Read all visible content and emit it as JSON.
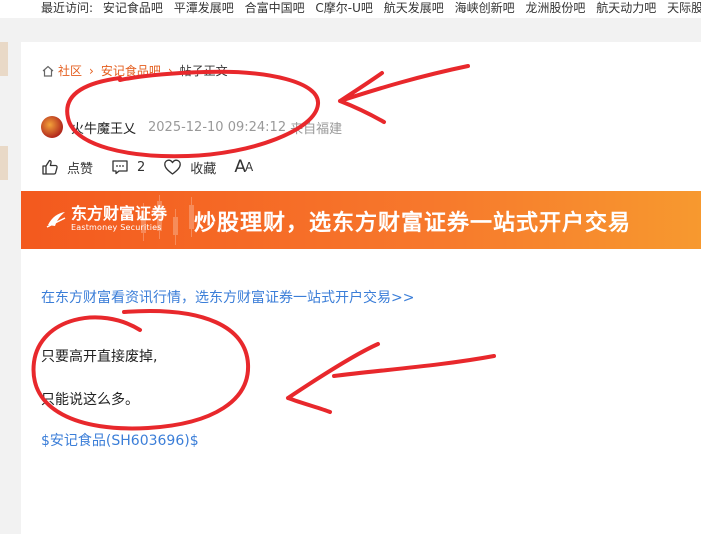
{
  "recent": {
    "label": "最近访问:",
    "items": [
      "安记食品吧",
      "平潭发展吧",
      "合富中国吧",
      "C摩尔-U吧",
      "航天发展吧",
      "海峡创新吧",
      "龙洲股份吧",
      "航天动力吧",
      "天际股份吧",
      "..."
    ]
  },
  "breadcrumb": {
    "home": "社区",
    "bar": "安记食品吧",
    "current": "帖子正文"
  },
  "author": {
    "name": "火牛魔王乂",
    "time": "2025-12-10 09:24:12",
    "location": "来自福建"
  },
  "actions": {
    "like": "点赞",
    "comments": "2",
    "favorite": "收藏",
    "font_big": "A",
    "font_small": "A"
  },
  "banner": {
    "logo_cn": "东方财富证券",
    "logo_en": "Eastmoney Securities",
    "slogan": "炒股理财，选东方财富证券一站式开户交易"
  },
  "post": {
    "promo_link": "在东方财富看资讯行情，选东方财富证券一站式开户交易>>",
    "lines": [
      "只要高开直接废掉,",
      "只能说这么多。"
    ],
    "stock_tag": "$安记食品(SH603696)$"
  },
  "colors": {
    "accent": "#e45e1e",
    "link": "#3b7ed8",
    "annotation": "#e8282c"
  }
}
